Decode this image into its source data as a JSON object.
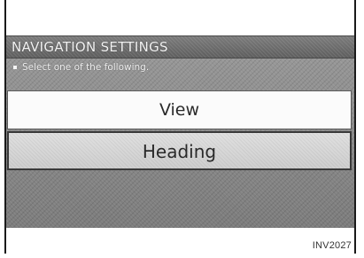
{
  "screen": {
    "title": "NAVIGATION SETTINGS",
    "instruction": "Select one of the following.",
    "options": [
      {
        "label": "View",
        "selected": false
      },
      {
        "label": "Heading",
        "selected": true
      }
    ]
  },
  "caption": "INV2027"
}
